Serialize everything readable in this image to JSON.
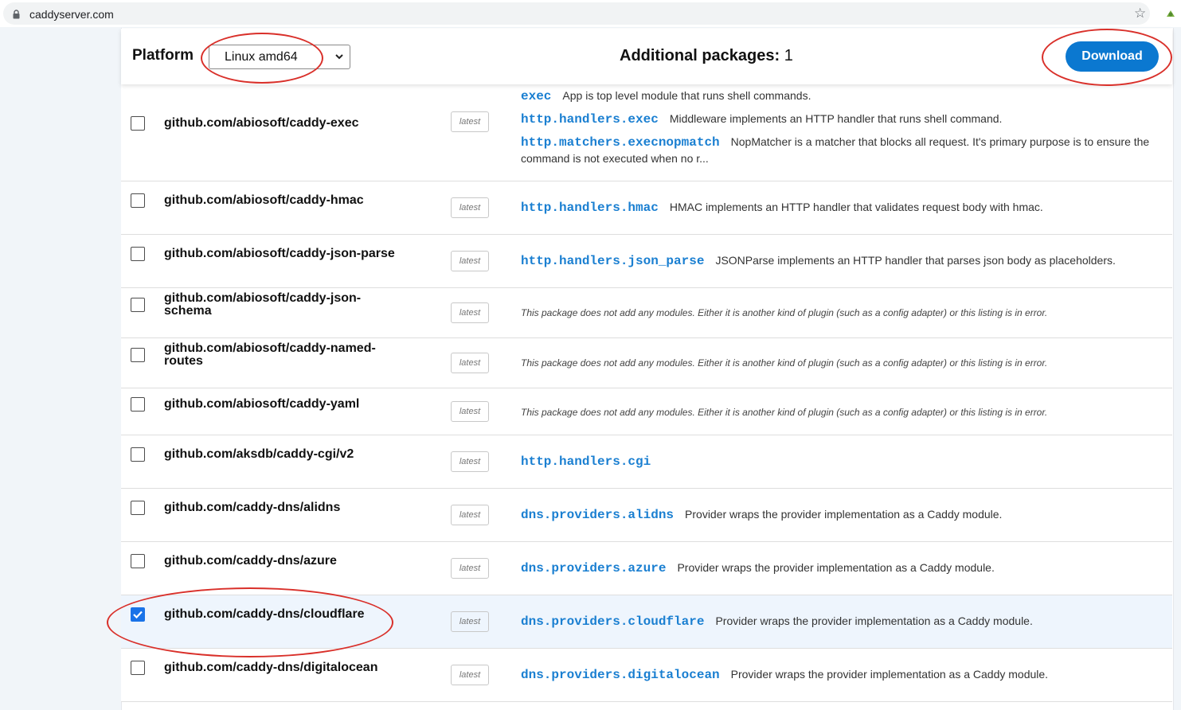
{
  "browser": {
    "url": "caddyserver.com",
    "icons": [
      "lock-icon",
      "star-icon",
      "extension-icon"
    ]
  },
  "header": {
    "platform_label": "Platform",
    "platform_value": "Linux amd64",
    "packages_label": "Additional packages:",
    "packages_count": "1",
    "download_label": "Download"
  },
  "colors": {
    "accent": "#0b78d0",
    "module_link": "#1a7fd1",
    "annotation": "#d9302a",
    "selected_row": "#eef5fd"
  },
  "rows": [
    {
      "package": "github.com/abiosoft/caddy-exec",
      "version": "latest",
      "checked": false,
      "modules": [
        {
          "id": "exec",
          "desc": "App is top level module that runs shell commands."
        },
        {
          "id": "http.handlers.exec",
          "desc": "Middleware implements an HTTP handler that runs shell command."
        },
        {
          "id": "http.matchers.execnopmatch",
          "desc": "NopMatcher is a matcher that blocks all request. It's primary purpose is to ensure the command is not executed when no r..."
        }
      ]
    },
    {
      "package": "github.com/abiosoft/caddy-hmac",
      "version": "latest",
      "checked": false,
      "modules": [
        {
          "id": "http.handlers.hmac",
          "desc": "HMAC implements an HTTP handler that validates request body with hmac."
        }
      ]
    },
    {
      "package": "github.com/abiosoft/caddy-json-parse",
      "version": "latest",
      "checked": false,
      "modules": [
        {
          "id": "http.handlers.json_parse",
          "desc": "JSONParse implements an HTTP handler that parses json body as placeholders."
        }
      ]
    },
    {
      "package": "github.com/abiosoft/caddy-json-schema",
      "version": "latest",
      "checked": false,
      "note": "This package does not add any modules. Either it is another kind of plugin (such as a config adapter) or this listing is in error."
    },
    {
      "package": "github.com/abiosoft/caddy-named-routes",
      "version": "latest",
      "checked": false,
      "note": "This package does not add any modules. Either it is another kind of plugin (such as a config adapter) or this listing is in error."
    },
    {
      "package": "github.com/abiosoft/caddy-yaml",
      "version": "latest",
      "checked": false,
      "note": "This package does not add any modules. Either it is another kind of plugin (such as a config adapter) or this listing is in error."
    },
    {
      "package": "github.com/aksdb/caddy-cgi/v2",
      "version": "latest",
      "checked": false,
      "modules": [
        {
          "id": "http.handlers.cgi",
          "desc": ""
        }
      ]
    },
    {
      "package": "github.com/caddy-dns/alidns",
      "version": "latest",
      "checked": false,
      "modules": [
        {
          "id": "dns.providers.alidns",
          "desc": "Provider wraps the provider implementation as a Caddy module."
        }
      ]
    },
    {
      "package": "github.com/caddy-dns/azure",
      "version": "latest",
      "checked": false,
      "modules": [
        {
          "id": "dns.providers.azure",
          "desc": "Provider wraps the provider implementation as a Caddy module."
        }
      ]
    },
    {
      "package": "github.com/caddy-dns/cloudflare",
      "version": "latest",
      "checked": true,
      "modules": [
        {
          "id": "dns.providers.cloudflare",
          "desc": "Provider wraps the provider implementation as a Caddy module."
        }
      ]
    },
    {
      "package": "github.com/caddy-dns/digitalocean",
      "version": "latest",
      "checked": false,
      "modules": [
        {
          "id": "dns.providers.digitalocean",
          "desc": "Provider wraps the provider implementation as a Caddy module."
        }
      ]
    }
  ]
}
